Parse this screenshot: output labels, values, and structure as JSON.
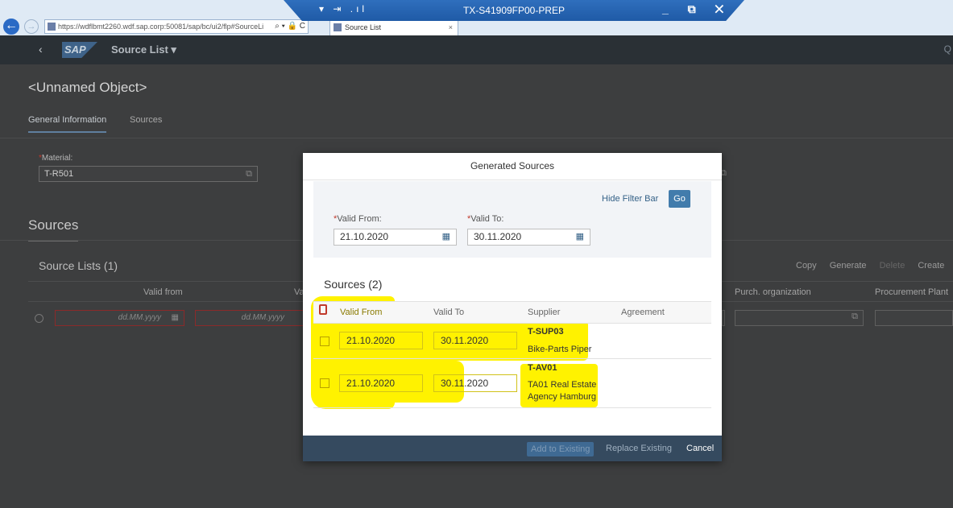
{
  "browser": {
    "url": "https://wdflbmt2260.wdf.sap.corp:50081/sap/bc/ui2/flp#SourceLi",
    "tab_title": "Source List",
    "address_tools": "⌕ ▾ 🔒 C",
    "tab_close": "×"
  },
  "remote_session": {
    "title": "TX-S41909FP00-PREP",
    "left_icons": "▾ ⇥ .ıl",
    "window_controls": "_ ⧉ ✕"
  },
  "shell": {
    "back": "‹",
    "logo": "SAP",
    "app_title": "Source List ▾",
    "search": "Q"
  },
  "page": {
    "object_title": "<Unnamed Object>",
    "tabs": [
      "General Information",
      "Sources"
    ],
    "material_label_req": "*",
    "material_label": "Material:",
    "material_value": "T-R501",
    "sources_heading": "Sources",
    "source_lists_title": "Source Lists (1)",
    "toolbar": [
      "Copy",
      "Generate",
      "Delete",
      "Create"
    ],
    "columns": [
      "Valid from",
      "Va",
      "Purch. organization",
      "Procurement Plant"
    ],
    "date_placeholder": "dd.MM.yyyy"
  },
  "dialog": {
    "title": "Generated Sources",
    "hide_filter_bar": "Hide Filter Bar",
    "go": "Go",
    "req_mark": "*",
    "valid_from_label": "Valid From:",
    "valid_to_label": "Valid To:",
    "valid_from_value": "21.10.2020",
    "valid_to_value": "30.11.2020",
    "sources_title": "Sources (2)",
    "columns": [
      "Valid From",
      "Valid To",
      "Supplier",
      "Agreement"
    ],
    "rows": [
      {
        "valid_from": "21.10.2020",
        "valid_to": "30.11.2020",
        "supplier_id": "T-SUP03",
        "supplier_name": "Bike-Parts Piper"
      },
      {
        "valid_from": "21.10.2020",
        "valid_to": "30.11.2020",
        "supplier_id": "T-AV01",
        "supplier_name": "TA01 Real Estate Agency Hamburg"
      }
    ],
    "buttons": {
      "add": "Add to Existing",
      "replace": "Replace Existing",
      "cancel": "Cancel"
    }
  },
  "colors": {
    "highlight": "#fff200",
    "shell": "#2a3035",
    "dialog_footer": "#354a5f",
    "accent": "#427cac"
  }
}
